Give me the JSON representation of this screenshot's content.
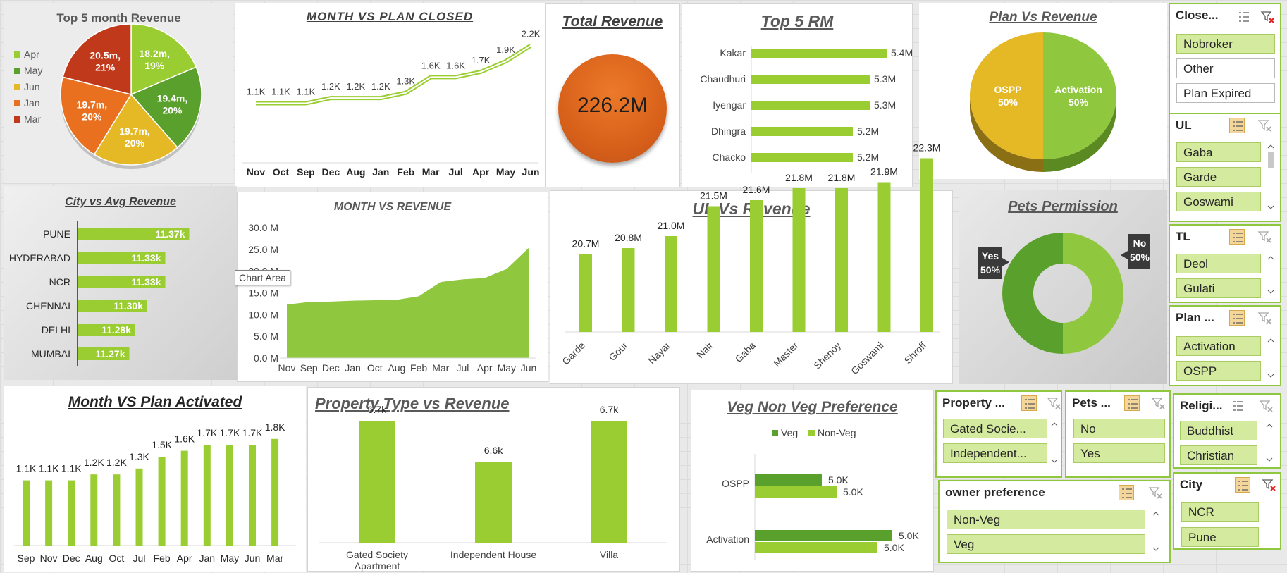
{
  "tooltip": "Chart Area",
  "colors": {
    "light_green": "#9acd32",
    "dark_green": "#5aa02c",
    "accent_orange": "#e8701f",
    "yellow": "#e5b825",
    "red": "#c0391b"
  },
  "total_revenue": {
    "title": "Total Revenue",
    "value": "226.2M"
  },
  "slicers": {
    "closed": {
      "title": "Close...",
      "items": [
        "Nobroker",
        "Other",
        "Plan Expired"
      ],
      "selected": [
        true,
        false,
        false
      ]
    },
    "ul": {
      "title": "UL",
      "items": [
        "Gaba",
        "Garde",
        "Goswami"
      ]
    },
    "tl": {
      "title": "TL",
      "items": [
        "Deol",
        "Gulati"
      ]
    },
    "plan": {
      "title": "Plan ...",
      "items": [
        "Activation",
        "OSPP"
      ]
    },
    "property": {
      "title": "Property ...",
      "items": [
        "Gated Socie...",
        "Independent..."
      ]
    },
    "pets": {
      "title": "Pets ...",
      "items": [
        "No",
        "Yes"
      ]
    },
    "religion": {
      "title": "Religi...",
      "items": [
        "Buddhist",
        "Christian"
      ]
    },
    "owner": {
      "title": "owner preference",
      "items": [
        "Non-Veg",
        "Veg"
      ]
    },
    "city": {
      "title": "City",
      "items": [
        "NCR",
        "Pune"
      ]
    }
  },
  "chart_data": [
    {
      "id": "top5_month_revenue",
      "type": "pie",
      "title": "Top 5 month Revenue",
      "categories": [
        "Apr",
        "May",
        "Jun",
        "Jan",
        "Mar"
      ],
      "values": [
        18.2,
        19.4,
        19.7,
        19.7,
        20.5
      ],
      "labels": [
        "18.2m,",
        "19.4m,",
        "19.7m,",
        "19.7m,",
        "20.5m,"
      ],
      "percents": [
        "19%",
        "20%",
        "20%",
        "20%",
        "21%"
      ],
      "colors": [
        "#9acd32",
        "#5aa02c",
        "#e5b825",
        "#e8701f",
        "#c0391b"
      ],
      "legend": "left"
    },
    {
      "id": "month_vs_plan_closed",
      "type": "line",
      "title": "MONTH VS PLAN CLOSED",
      "categories": [
        "Nov",
        "Oct",
        "Sep",
        "Dec",
        "Aug",
        "Jan",
        "Feb",
        "Mar",
        "Jul",
        "Apr",
        "May",
        "Jun"
      ],
      "values": [
        1.1,
        1.1,
        1.1,
        1.2,
        1.2,
        1.2,
        1.3,
        1.6,
        1.6,
        1.7,
        1.9,
        2.2
      ],
      "labels": [
        "1.1K",
        "1.1K",
        "1.1K",
        "1.2K",
        "1.2K",
        "1.2K",
        "1.3K",
        "1.6K",
        "1.6K",
        "1.7K",
        "1.9K",
        "2.2K"
      ]
    },
    {
      "id": "top5_rm",
      "type": "bar",
      "orientation": "horizontal",
      "title": "Top 5 RM",
      "categories": [
        "Kakar",
        "Chaudhuri",
        "Iyengar",
        "Dhingra",
        "Chacko"
      ],
      "values": [
        5.4,
        5.3,
        5.3,
        5.2,
        5.2
      ],
      "labels": [
        "5.4M",
        "5.3M",
        "5.3M",
        "5.2M",
        "5.2M"
      ]
    },
    {
      "id": "plan_vs_revenue",
      "type": "pie",
      "title": "Plan Vs Revenue",
      "categories": [
        "Activation",
        "OSPP"
      ],
      "values": [
        50,
        50
      ],
      "percents": [
        "50%",
        "50%"
      ],
      "colors": [
        "#8fc73e",
        "#e5b825"
      ]
    },
    {
      "id": "city_vs_avg_revenue",
      "type": "bar",
      "orientation": "horizontal",
      "title": "City vs Avg Revenue",
      "categories": [
        "PUNE",
        "HYDERABAD",
        "NCR",
        "CHENNAI",
        "DELHI",
        "MUMBAI"
      ],
      "values": [
        11.37,
        11.33,
        11.33,
        11.3,
        11.28,
        11.27
      ],
      "labels": [
        "11.37k",
        "11.33k",
        "11.33k",
        "11.30k",
        "11.28k",
        "11.27k"
      ]
    },
    {
      "id": "month_vs_revenue",
      "type": "area",
      "title": "MONTH VS REVENUE",
      "categories": [
        "Nov",
        "Sep",
        "Dec",
        "Jan",
        "Oct",
        "Aug",
        "Feb",
        "Mar",
        "Jul",
        "Apr",
        "May",
        "Jun"
      ],
      "values": [
        12.3,
        12.9,
        13.0,
        13.2,
        13.3,
        13.4,
        14.2,
        17.5,
        18.1,
        18.4,
        20.5,
        25.3
      ],
      "ticks": [
        "0.0 M",
        "5.0 M",
        "10.0 M",
        "15.0 M",
        "20.0 M",
        "25.0 M",
        "30.0 M"
      ],
      "ylim": [
        0,
        30
      ]
    },
    {
      "id": "ul_vs_revenue",
      "type": "bar",
      "title": "UL Vs Revenue",
      "categories": [
        "Garde",
        "Gour",
        "Nayar",
        "Nair",
        "Gaba",
        "Master",
        "Shenoy",
        "Goswami",
        "Shroff"
      ],
      "values": [
        20.7,
        20.8,
        21.0,
        21.5,
        21.6,
        21.8,
        21.8,
        21.9,
        22.3
      ],
      "labels": [
        "20.7M",
        "20.8M",
        "21.0M",
        "21.5M",
        "21.6M",
        "21.8M",
        "21.8M",
        "21.9M",
        "22.3M"
      ]
    },
    {
      "id": "pets_permission",
      "type": "pie",
      "title": "Pets Permission",
      "categories": [
        "No",
        "Yes"
      ],
      "values": [
        50,
        50
      ],
      "percents": [
        "50%",
        "50%"
      ],
      "colors": [
        "#8fc73e",
        "#5aa02c"
      ]
    },
    {
      "id": "month_vs_plan_activated",
      "type": "bar",
      "title": "Month VS Plan Activated",
      "categories": [
        "Sep",
        "Nov",
        "Dec",
        "Aug",
        "Oct",
        "Jul",
        "Feb",
        "Apr",
        "Jan",
        "May",
        "Jun",
        "Mar"
      ],
      "values": [
        1.1,
        1.1,
        1.1,
        1.2,
        1.2,
        1.3,
        1.5,
        1.6,
        1.7,
        1.7,
        1.7,
        1.8
      ],
      "labels": [
        "1.1K",
        "1.1K",
        "1.1K",
        "1.2K",
        "1.2K",
        "1.3K",
        "1.5K",
        "1.6K",
        "1.7K",
        "1.7K",
        "1.7K",
        "1.8K"
      ]
    },
    {
      "id": "property_type_vs_revenue",
      "type": "bar",
      "title": "Property Type vs Revenue",
      "categories": [
        "Gated Society Apartment",
        "Independent House",
        "Villa"
      ],
      "values": [
        6.7,
        6.6,
        6.7
      ],
      "labels": [
        "6.7k",
        "6.6k",
        "6.7k"
      ]
    },
    {
      "id": "veg_nonveg_preference",
      "type": "bar",
      "orientation": "horizontal",
      "title": "Veg Non Veg Preference",
      "categories": [
        "OSPP",
        "Activation"
      ],
      "series": [
        {
          "name": "Veg",
          "values": [
            4.95,
            5.05
          ],
          "labels": [
            "5.0K",
            "5.0K"
          ]
        },
        {
          "name": "Non-Veg",
          "values": [
            5.05,
            4.95
          ],
          "labels": [
            "5.0K",
            "5.0K"
          ]
        }
      ],
      "legend": "top"
    }
  ]
}
